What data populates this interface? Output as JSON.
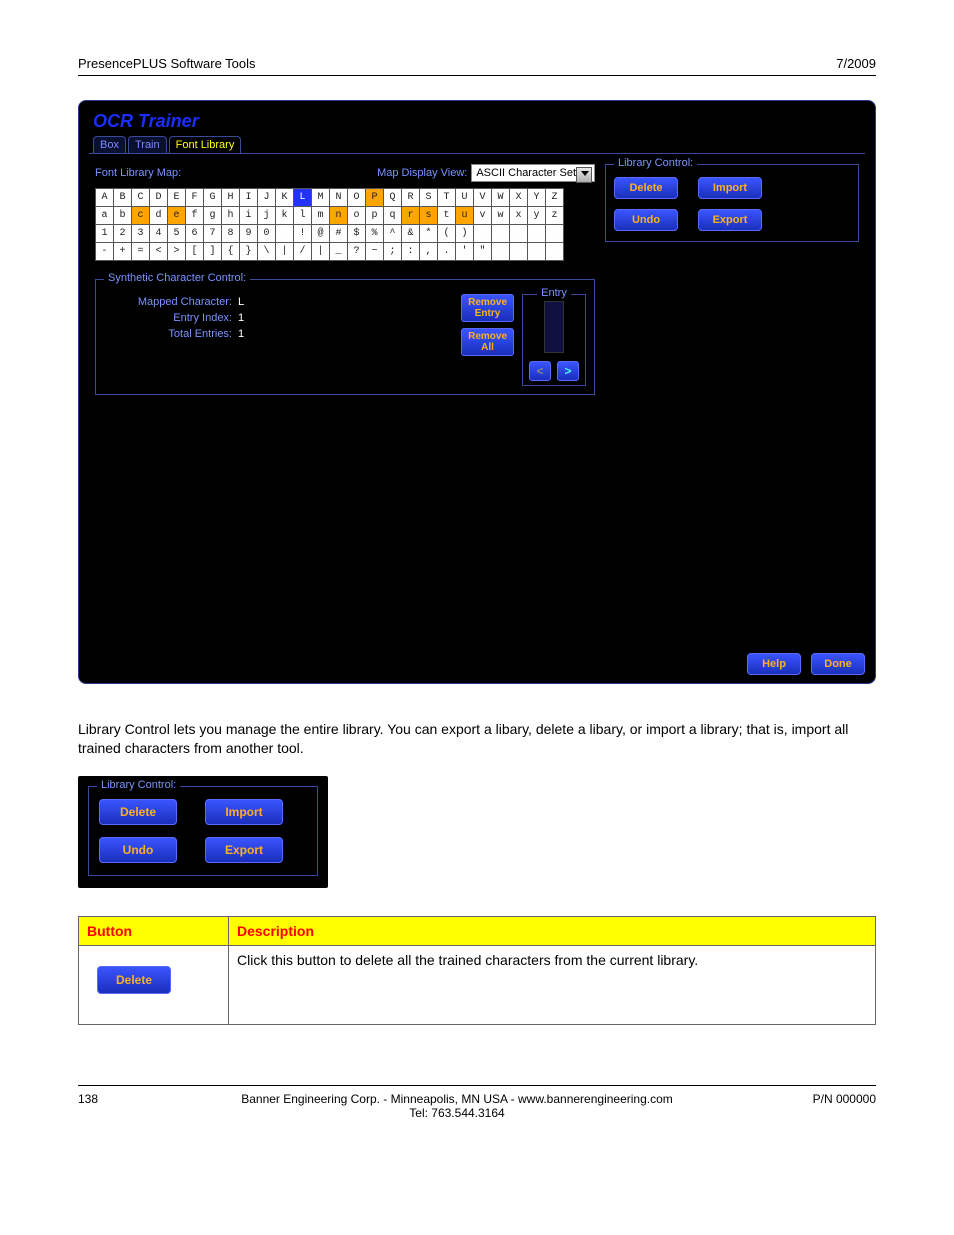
{
  "header": {
    "left": "PresencePLUS Software Tools",
    "right": "7/2009"
  },
  "win": {
    "title": "OCR Trainer",
    "tabs": [
      "Box",
      "Train",
      "Font Library"
    ],
    "active_tab": 2,
    "font_library_map_label": "Font Library Map:",
    "map_display_view_label": "Map Display View:",
    "map_display_view_value": "ASCII Character Set",
    "rows": [
      [
        "A",
        "B",
        "C",
        "D",
        "E",
        "F",
        "G",
        "H",
        "I",
        "J",
        "K",
        "L",
        "M",
        "N",
        "O",
        "P",
        "Q",
        "R",
        "S",
        "T",
        "U",
        "V",
        "W",
        "X",
        "Y",
        "Z"
      ],
      [
        "a",
        "b",
        "c",
        "d",
        "e",
        "f",
        "g",
        "h",
        "i",
        "j",
        "k",
        "l",
        "m",
        "n",
        "o",
        "p",
        "q",
        "r",
        "s",
        "t",
        "u",
        "v",
        "w",
        "x",
        "y",
        "z"
      ],
      [
        "1",
        "2",
        "3",
        "4",
        "5",
        "6",
        "7",
        "8",
        "9",
        "0",
        "",
        "!",
        "@",
        "#",
        "$",
        "%",
        "^",
        "&",
        "*",
        "(",
        ")",
        "",
        "",
        "",
        "",
        ""
      ],
      [
        "-",
        "+",
        "=",
        "<",
        ">",
        "[",
        "]",
        "{",
        "}",
        "\\",
        "|",
        "/",
        "|",
        "_",
        "?",
        "~",
        ";",
        ":",
        ",",
        ".",
        "'",
        "\"",
        "",
        "",
        "",
        ""
      ]
    ],
    "selected": "L",
    "orange": [
      "c",
      "e",
      "n",
      "P",
      "r",
      "s",
      "u"
    ],
    "scc": {
      "legend": "Synthetic Character Control:",
      "mapped_label": "Mapped Character:",
      "mapped_value": "L",
      "entry_index_label": "Entry Index:",
      "entry_index_value": "1",
      "total_entries_label": "Total Entries:",
      "total_entries_value": "1",
      "remove_entry_label": "Remove\nEntry",
      "remove_all_label": "Remove\nAll",
      "entry_legend": "Entry",
      "prev": "<",
      "next": ">"
    },
    "library_control": {
      "legend": "Library Control:",
      "delete": "Delete",
      "import": "Import",
      "undo": "Undo",
      "export": "Export"
    },
    "help": "Help",
    "done": "Done"
  },
  "body_paragraph": "Library Control lets you manage the entire library. You can export a libary, delete a libary, or import a library; that is, import all trained characters from another tool.",
  "lib_crop": {
    "legend": "Library Control:",
    "delete": "Delete",
    "import": "Import",
    "undo": "Undo",
    "export": "Export"
  },
  "table": {
    "h_button": "Button",
    "h_desc": "Description",
    "row_delete_btn": "Delete",
    "row_delete_desc": "Click this button to delete all the trained characters from the current library."
  },
  "footer": {
    "page": "138",
    "center1": "Banner Engineering Corp. - Minneapolis, MN USA - www.bannerengineering.com",
    "center2": "Tel: 763.544.3164",
    "right": "P/N 000000"
  }
}
